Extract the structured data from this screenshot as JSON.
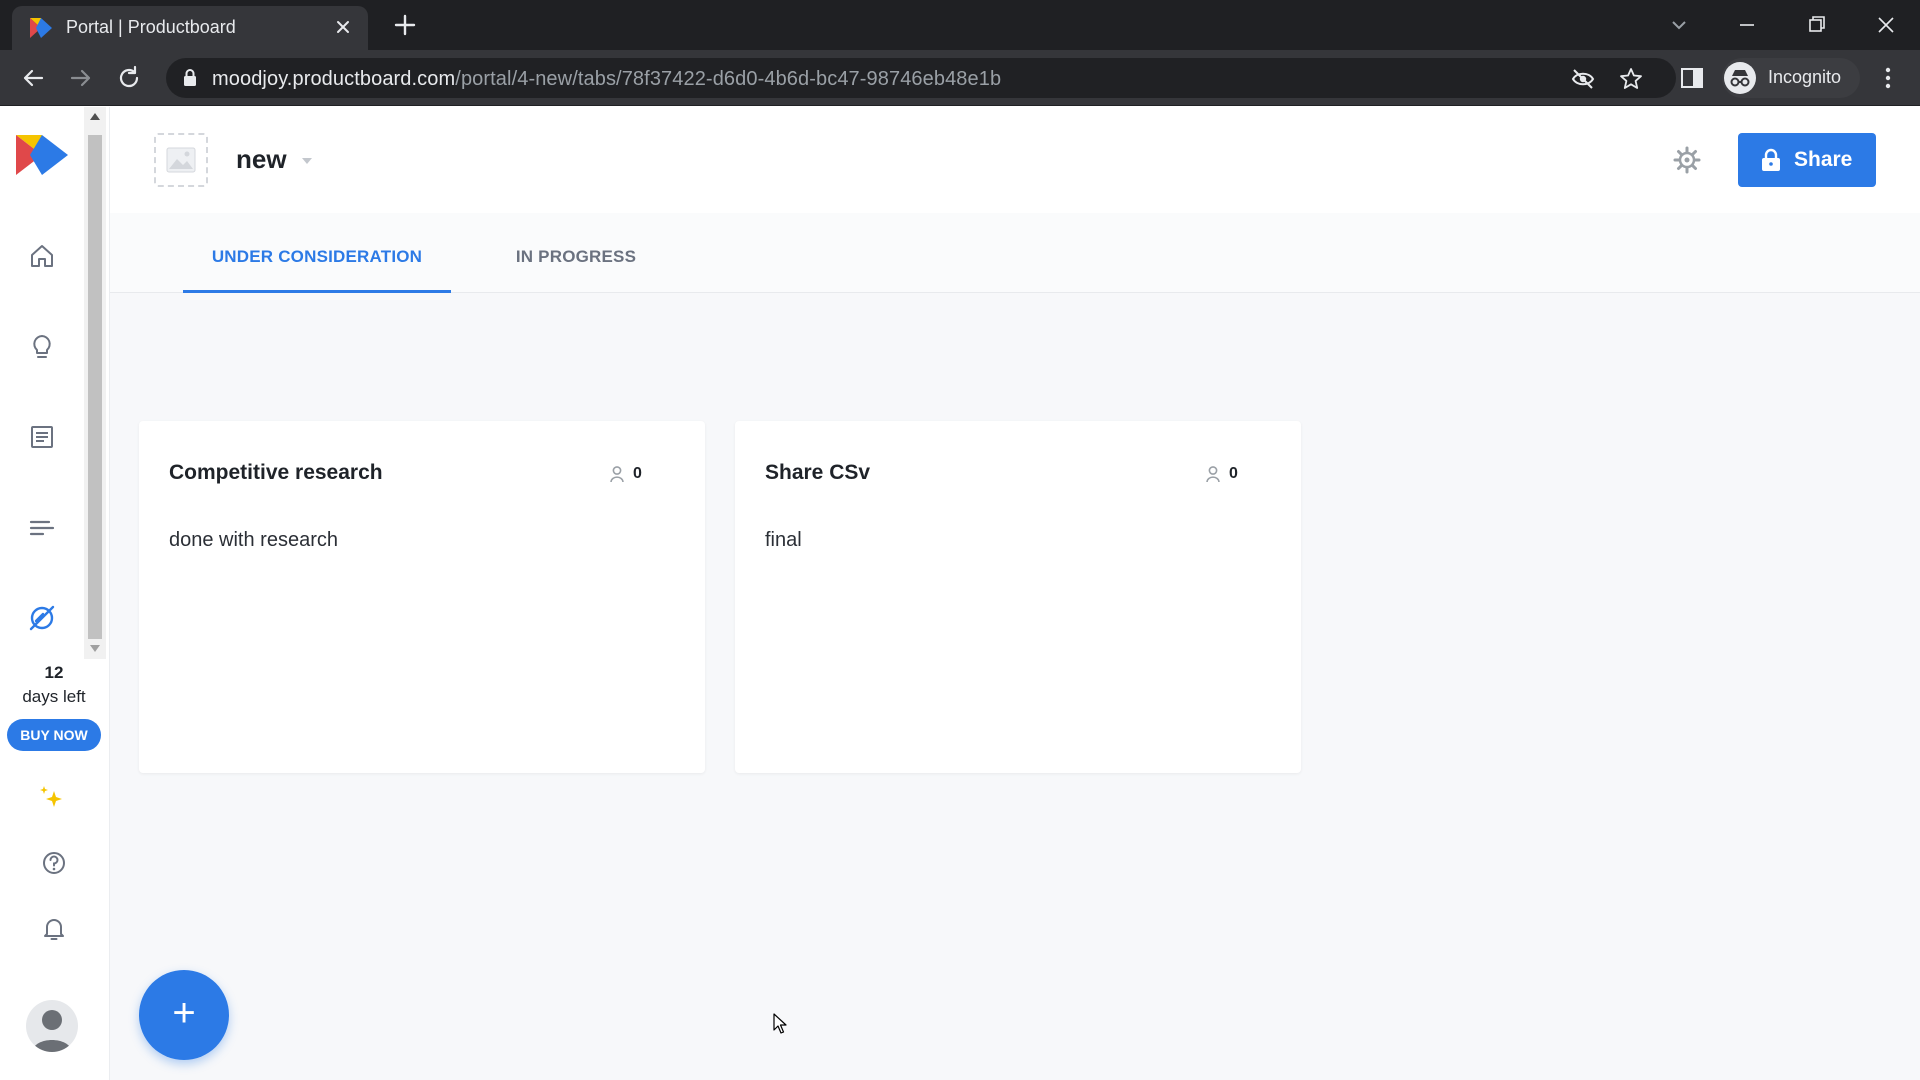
{
  "browser": {
    "tab_title": "Portal | Productboard",
    "url_host": "moodjoy.productboard.com",
    "url_path": "/portal/4-new/tabs/78f37422-d6d0-4b6d-bc47-98746eb48e1b",
    "profile_label": "Incognito"
  },
  "sidebar": {
    "trial_days": "12",
    "trial_label": "days left",
    "buy_label": "BUY NOW",
    "icons": [
      "productboard-logo-icon",
      "home-icon",
      "lightbulb-icon",
      "notes-icon",
      "roadmap-icon",
      "portal-icon",
      "sparkle-icon",
      "help-icon",
      "bell-icon",
      "avatar"
    ]
  },
  "header": {
    "portal_name": "new",
    "share_label": "Share"
  },
  "tabs": [
    {
      "label": "UNDER CONSIDERATION",
      "active": true
    },
    {
      "label": "IN PROGRESS",
      "active": false
    }
  ],
  "cards": [
    {
      "title": "Competitive research",
      "votes": "0",
      "description": "done with research"
    },
    {
      "title": "Share CSv",
      "votes": "0",
      "description": "final"
    }
  ],
  "fab": {
    "label": "+"
  },
  "colors": {
    "accent": "#2c7ae6",
    "chrome_dark": "#35363a",
    "content_bg": "#f7f8fa"
  }
}
